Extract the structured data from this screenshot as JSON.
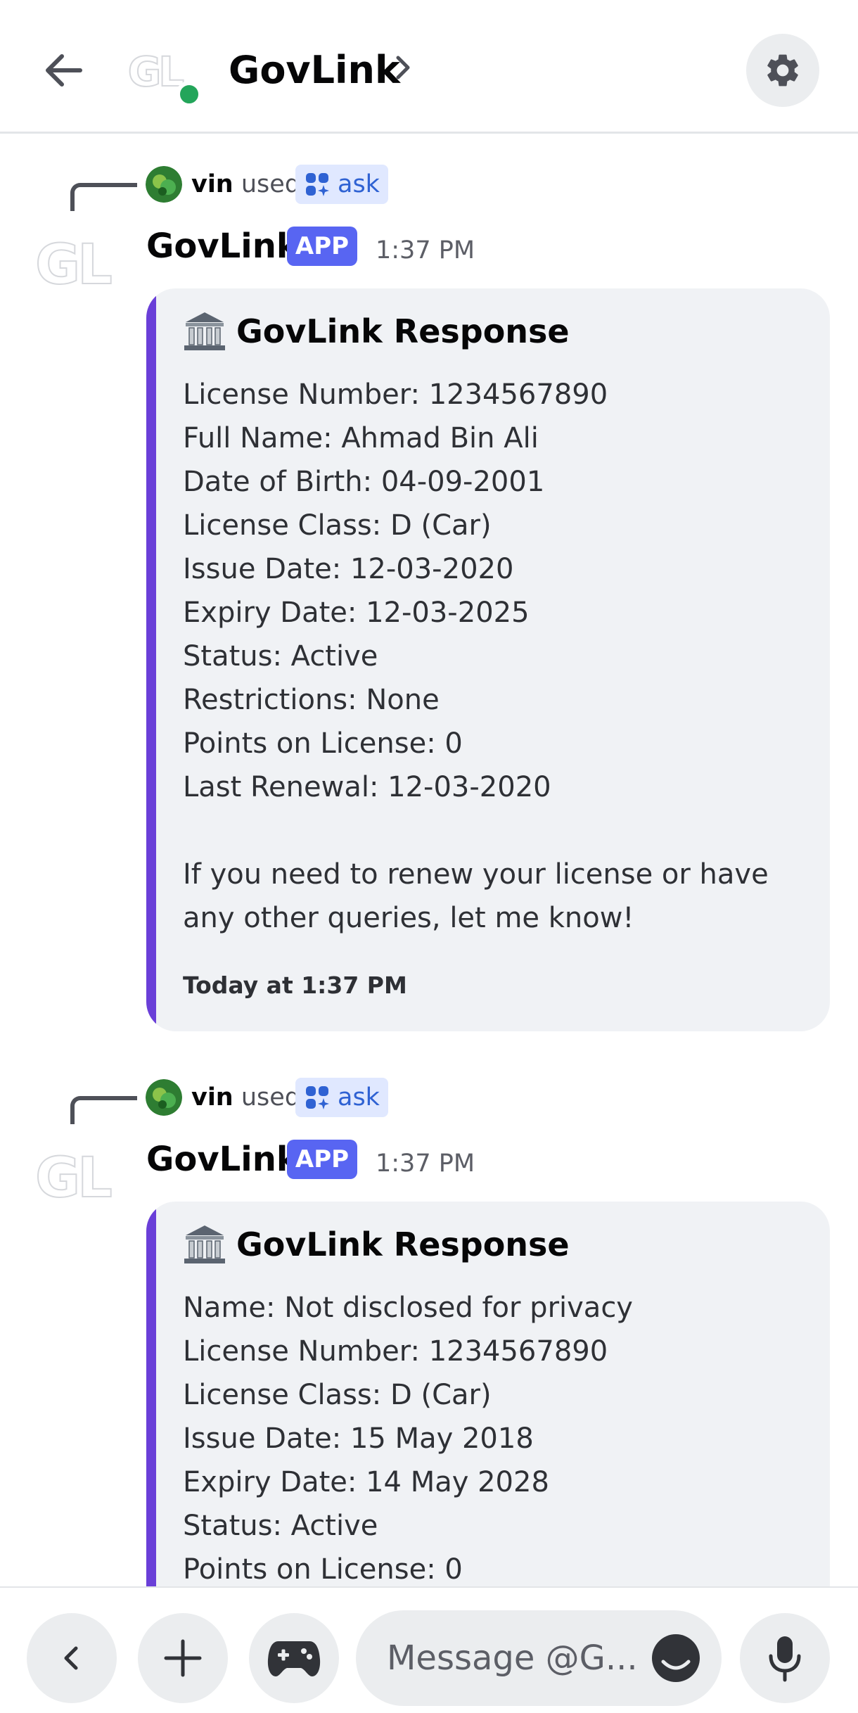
{
  "header": {
    "title": "GovLink",
    "avatar_text": "GL"
  },
  "messages": [
    {
      "reply": {
        "user": "vin",
        "used_text": "used",
        "command": "ask"
      },
      "author": "GovLink",
      "badge": "APP",
      "time": "1:37 PM",
      "embed": {
        "title": "GovLink Response",
        "lines": [
          "License Number: 1234567890",
          "Full Name: Ahmad Bin Ali",
          "Date of Birth: 04-09-2001",
          "License Class: D (Car)",
          "Issue Date: 12-03-2020",
          "Expiry Date: 12-03-2025",
          "Status: Active",
          "Restrictions: None",
          "Points on License: 0",
          "Last Renewal: 12-03-2020",
          "",
          "If you need to renew your license or have",
          "any other queries, let me know!"
        ],
        "footer": "Today at 1:37 PM"
      }
    },
    {
      "reply": {
        "user": "vin",
        "used_text": "used",
        "command": "ask"
      },
      "author": "GovLink",
      "badge": "APP",
      "time": "1:37 PM",
      "embed": {
        "title": "GovLink Response",
        "lines": [
          "Name: Not disclosed for privacy",
          "License Number: 1234567890",
          "License Class: D (Car)",
          "Issue Date: 15 May 2018",
          "Expiry Date: 14 May 2028",
          "Status: Active",
          "Points on License: 0"
        ]
      }
    }
  ],
  "composer": {
    "placeholder": "Message @G..."
  },
  "colors": {
    "accent": "#5865f2",
    "embed_bar": "#6a3fd8",
    "online": "#23a55a",
    "command_pill_bg": "#e0e8ff",
    "command_pill_text": "#2f62d3"
  },
  "icons": [
    "back-arrow-icon",
    "chevron-right-icon",
    "gear-icon",
    "command-icon",
    "bank-icon",
    "chevron-left-icon",
    "plus-icon",
    "gamepad-icon",
    "emoji-icon",
    "microphone-icon"
  ]
}
